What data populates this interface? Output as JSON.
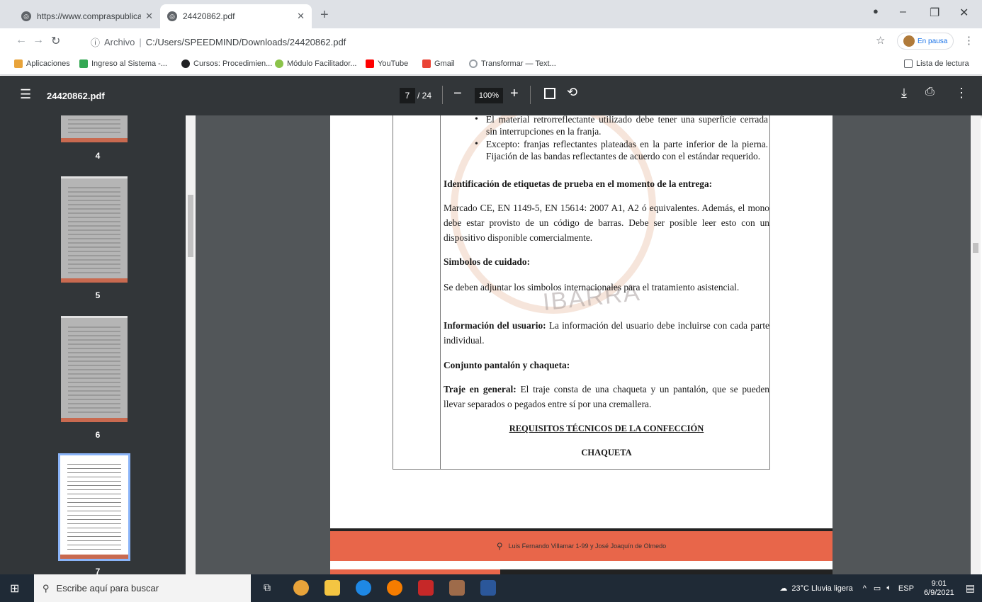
{
  "browser": {
    "tabs": [
      {
        "title": "https://www.compraspublicas.g",
        "active": false
      },
      {
        "title": "24420862.pdf",
        "active": true
      }
    ],
    "new_tab": "+",
    "url_prefix": "Archivo",
    "url": "C:/Users/SPEEDMIND/Downloads/24420862.pdf",
    "profile": "En pausa",
    "bookmarks": [
      {
        "label": "Aplicaciones",
        "color": "#e8a33a"
      },
      {
        "label": "Ingreso al Sistema -...",
        "color": "#34a853"
      },
      {
        "label": "Cursos: Procedimien...",
        "color": "#202124"
      },
      {
        "label": "Módulo Facilitador...",
        "color": "#8bc34a"
      },
      {
        "label": "YouTube",
        "color": "#ff0000"
      },
      {
        "label": "Gmail",
        "color": "#ea4335"
      },
      {
        "label": "Transformar — Text...",
        "color": "#9aa0a6"
      }
    ],
    "reading_list": "Lista de lectura"
  },
  "pdf": {
    "filename": "24420862.pdf",
    "page_current": "7",
    "page_total": "/ 24",
    "zoom": "100%",
    "thumbnails": [
      {
        "label": "4"
      },
      {
        "label": "5"
      },
      {
        "label": "6"
      },
      {
        "label": "7"
      }
    ]
  },
  "document": {
    "bullet1": "El material retrorreflectante utilizado debe tener una superficie cerrada sin interrupciones en la franja.",
    "bullet2": "Excepto: franjas reflectantes plateadas en la parte inferior de la pierna. Fijación de las bandas reflectantes de acuerdo con el estándar requerido.",
    "heading_labels": "Identificación de etiquetas de prueba en el momento de la entrega:",
    "para_marcado": "Marcado CE, EN 1149-5, EN 15614: 2007 A1, A2 ó equivalentes. Además, el mono debe estar provisto de un código de barras. Debe ser posible leer esto con un dispositivo disponible comercialmente.",
    "heading_simbolos": "Simbolos de cuidado:",
    "para_simbolos": "Se deben adjuntar los simbolos internacionales para el tratamiento asistencial.",
    "info_label": "Información del usuario:",
    "info_text": " La información del usuario debe incluirse con cada parte individual.",
    "heading_conjunto": "Conjunto pantalón y chaqueta:",
    "traje_label": "Traje en general:",
    "traje_text": " El traje consta de una chaqueta y un pantalón, que se pueden llevar separados o pegados entre sí por una cremallera.",
    "heading_requisitos": "REQUISITOS TÉCNICOS DE LA CONFECCIÓN",
    "heading_chaqueta": "CHAQUETA",
    "watermark": "IBARRA",
    "footer_address": "Luis Fernando Villamar 1-99 y José Joaquín de Olmedo"
  },
  "taskbar": {
    "search_placeholder": "Escribe aquí para buscar",
    "weather": "23°C  Lluvia ligera",
    "lang": "ESP",
    "time": "9:01",
    "date": "6/9/2021"
  }
}
